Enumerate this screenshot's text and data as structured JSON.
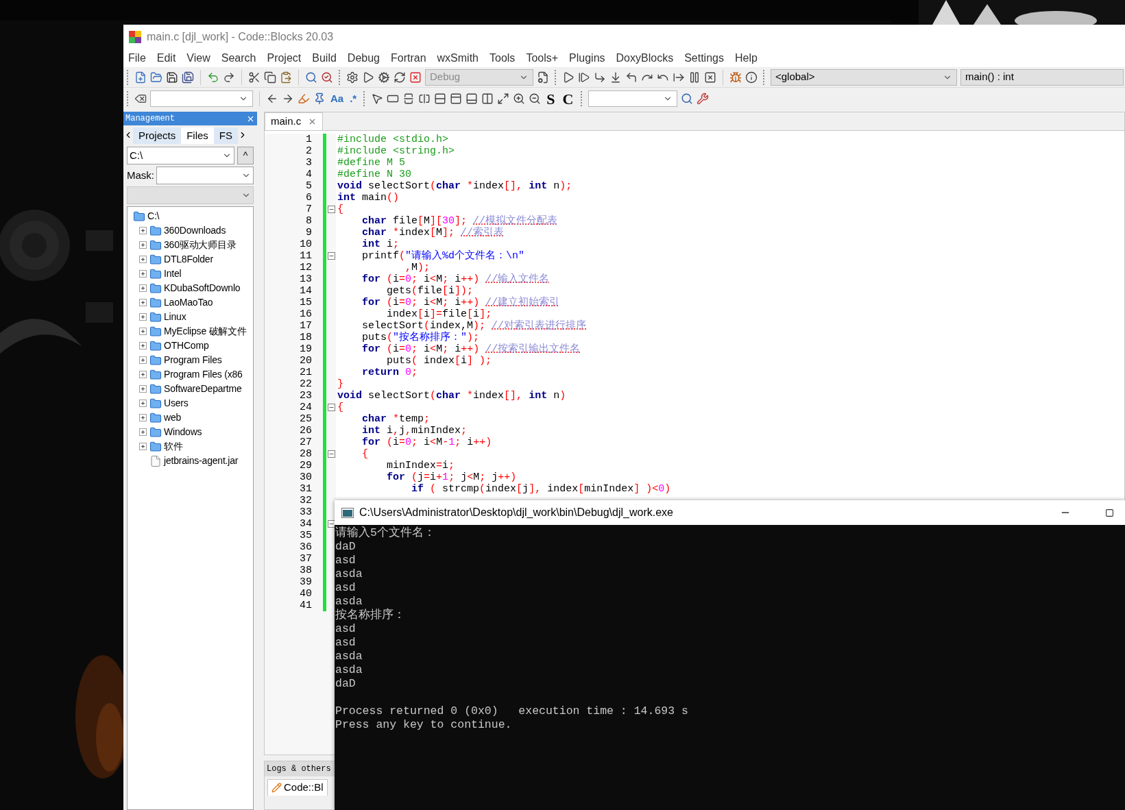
{
  "window": {
    "title": "main.c [djl_work] - Code::Blocks 20.03"
  },
  "menu": [
    "File",
    "Edit",
    "View",
    "Search",
    "Project",
    "Build",
    "Debug",
    "Fortran",
    "wxSmith",
    "Tools",
    "Tools+",
    "Plugins",
    "DoxyBlocks",
    "Settings",
    "Help"
  ],
  "toolbar": {
    "build_target": {
      "value": "Debug",
      "disabled": true
    },
    "scope": "<global>",
    "function": "main() : int",
    "text_buttons": [
      "Aa",
      ".*"
    ],
    "letter_buttons": [
      "S",
      "C"
    ]
  },
  "management": {
    "title": "Management",
    "tabs": [
      {
        "label": "Projects",
        "selected": false
      },
      {
        "label": "Files",
        "selected": true
      },
      {
        "label": "FS",
        "selected": false
      }
    ],
    "path": "C:\\",
    "up_button": "^",
    "mask_label": "Mask:",
    "tree": [
      {
        "label": "C:\\",
        "kind": "folder",
        "children": [
          {
            "label": "360Downloads",
            "kind": "folder",
            "expanded": false
          },
          {
            "label": "360驱动大师目录",
            "kind": "folder",
            "expanded": false
          },
          {
            "label": "DTL8Folder",
            "kind": "folder",
            "expanded": false
          },
          {
            "label": "Intel",
            "kind": "folder",
            "expanded": false
          },
          {
            "label": "KDubaSoftDownlo",
            "kind": "folder",
            "expanded": false
          },
          {
            "label": "LaoMaoTao",
            "kind": "folder",
            "expanded": false
          },
          {
            "label": "Linux",
            "kind": "folder",
            "expanded": false
          },
          {
            "label": "MyEclipse 破解文件",
            "kind": "folder",
            "expanded": false
          },
          {
            "label": "OTHComp",
            "kind": "folder",
            "expanded": false
          },
          {
            "label": "Program Files",
            "kind": "folder",
            "expanded": false
          },
          {
            "label": "Program Files (x86",
            "kind": "folder",
            "expanded": false
          },
          {
            "label": "SoftwareDepartme",
            "kind": "folder",
            "expanded": false
          },
          {
            "label": "Users",
            "kind": "folder",
            "expanded": false
          },
          {
            "label": "web",
            "kind": "folder",
            "expanded": false
          },
          {
            "label": "Windows",
            "kind": "folder",
            "expanded": false
          },
          {
            "label": "软件",
            "kind": "folder",
            "expanded": false
          },
          {
            "label": "jetbrains-agent.jar",
            "kind": "file"
          }
        ]
      }
    ]
  },
  "editor": {
    "tabs": [
      {
        "label": "main.c",
        "selected": true
      }
    ],
    "gutter": [
      {
        "number": "1",
        "fold": false
      },
      {
        "number": "2",
        "fold": false
      },
      {
        "number": "3",
        "fold": false
      },
      {
        "number": "4",
        "fold": false
      },
      {
        "number": "5",
        "fold": false
      },
      {
        "number": "6",
        "fold": false
      },
      {
        "number": "7",
        "fold": true
      },
      {
        "number": "8",
        "fold": false
      },
      {
        "number": "9",
        "fold": false
      },
      {
        "number": "10",
        "fold": false
      },
      {
        "number": "11",
        "fold": true
      },
      {
        "number": "12",
        "fold": false
      },
      {
        "number": "13",
        "fold": false
      },
      {
        "number": "14",
        "fold": false
      },
      {
        "number": "15",
        "fold": false
      },
      {
        "number": "16",
        "fold": false
      },
      {
        "number": "17",
        "fold": false
      },
      {
        "number": "18",
        "fold": false
      },
      {
        "number": "19",
        "fold": false
      },
      {
        "number": "20",
        "fold": false
      },
      {
        "number": "21",
        "fold": false
      },
      {
        "number": "22",
        "fold": false
      },
      {
        "number": "23",
        "fold": false
      },
      {
        "number": "24",
        "fold": true
      },
      {
        "number": "25",
        "fold": false
      },
      {
        "number": "26",
        "fold": false
      },
      {
        "number": "27",
        "fold": false
      },
      {
        "number": "28",
        "fold": true
      },
      {
        "number": "29",
        "fold": false
      },
      {
        "number": "30",
        "fold": false
      },
      {
        "number": "31",
        "fold": false
      },
      {
        "number": "32",
        "fold": false
      },
      {
        "number": "33",
        "fold": false
      },
      {
        "number": "34",
        "fold": true
      },
      {
        "number": "35",
        "fold": false
      },
      {
        "number": "36",
        "fold": false
      },
      {
        "number": "37",
        "fold": false
      },
      {
        "number": "38",
        "fold": false
      },
      {
        "number": "39",
        "fold": false
      },
      {
        "number": "40",
        "fold": false
      },
      {
        "number": "41",
        "fold": false
      }
    ],
    "code": [
      {
        "tokens": [
          {
            "kind": "pp",
            "text": "#include <stdio.h>"
          }
        ]
      },
      {
        "tokens": [
          {
            "kind": "pp",
            "text": "#include <string.h>"
          }
        ]
      },
      {
        "tokens": [
          {
            "kind": "pp",
            "text": "#define M 5"
          }
        ]
      },
      {
        "tokens": [
          {
            "kind": "pp",
            "text": "#define N 30"
          }
        ]
      },
      {
        "tokens": [
          {
            "kind": "kw",
            "text": "void"
          },
          {
            "kind": "p",
            "text": " selectSort"
          },
          {
            "kind": "op",
            "text": "("
          },
          {
            "kind": "kw",
            "text": "char"
          },
          {
            "kind": "op",
            "text": " *"
          },
          {
            "kind": "p",
            "text": "index"
          },
          {
            "kind": "op",
            "text": "[],"
          },
          {
            "kind": "kw",
            "text": " int"
          },
          {
            "kind": "p",
            "text": " n"
          },
          {
            "kind": "op",
            "text": ");"
          }
        ]
      },
      {
        "tokens": [
          {
            "kind": "kw",
            "text": "int"
          },
          {
            "kind": "p",
            "text": " main"
          },
          {
            "kind": "op",
            "text": "()"
          }
        ]
      },
      {
        "tokens": [
          {
            "kind": "op",
            "text": "{"
          }
        ]
      },
      {
        "tokens": [
          {
            "kind": "kw",
            "text": "    char"
          },
          {
            "kind": "p",
            "text": " file"
          },
          {
            "kind": "op",
            "text": "["
          },
          {
            "kind": "p",
            "text": "M"
          },
          {
            "kind": "op",
            "text": "]["
          },
          {
            "kind": "num",
            "text": "30"
          },
          {
            "kind": "op",
            "text": "]; "
          },
          {
            "kind": "cmt",
            "text": "//模拟文件分配表"
          }
        ]
      },
      {
        "tokens": [
          {
            "kind": "kw",
            "text": "    char"
          },
          {
            "kind": "op",
            "text": " *"
          },
          {
            "kind": "p",
            "text": "index"
          },
          {
            "kind": "op",
            "text": "["
          },
          {
            "kind": "p",
            "text": "M"
          },
          {
            "kind": "op",
            "text": "]; "
          },
          {
            "kind": "cmt",
            "text": "//索引表"
          }
        ]
      },
      {
        "tokens": [
          {
            "kind": "kw",
            "text": "    int"
          },
          {
            "kind": "p",
            "text": " i"
          },
          {
            "kind": "op",
            "text": ";"
          }
        ]
      },
      {
        "tokens": [
          {
            "kind": "p",
            "text": "    printf"
          },
          {
            "kind": "op",
            "text": "("
          },
          {
            "kind": "str",
            "text": "\"请输入%d个文件名：\\n\""
          }
        ]
      },
      {
        "tokens": [
          {
            "kind": "op",
            "text": "           ,"
          },
          {
            "kind": "p",
            "text": "M"
          },
          {
            "kind": "op",
            "text": ");"
          }
        ]
      },
      {
        "tokens": [
          {
            "kind": "kw",
            "text": "    for"
          },
          {
            "kind": "op",
            "text": " ("
          },
          {
            "kind": "p",
            "text": "i"
          },
          {
            "kind": "op",
            "text": "="
          },
          {
            "kind": "num",
            "text": "0"
          },
          {
            "kind": "op",
            "text": ";"
          },
          {
            "kind": "p",
            "text": " i"
          },
          {
            "kind": "op",
            "text": "<"
          },
          {
            "kind": "p",
            "text": "M"
          },
          {
            "kind": "op",
            "text": ";"
          },
          {
            "kind": "p",
            "text": " i"
          },
          {
            "kind": "op",
            "text": "++) "
          },
          {
            "kind": "cmt",
            "text": "//输入文件名"
          }
        ]
      },
      {
        "tokens": [
          {
            "kind": "p",
            "text": "        gets"
          },
          {
            "kind": "op",
            "text": "("
          },
          {
            "kind": "p",
            "text": "file"
          },
          {
            "kind": "op",
            "text": "["
          },
          {
            "kind": "p",
            "text": "i"
          },
          {
            "kind": "op",
            "text": "]);"
          }
        ]
      },
      {
        "tokens": [
          {
            "kind": "kw",
            "text": "    for"
          },
          {
            "kind": "op",
            "text": " ("
          },
          {
            "kind": "p",
            "text": "i"
          },
          {
            "kind": "op",
            "text": "="
          },
          {
            "kind": "num",
            "text": "0"
          },
          {
            "kind": "op",
            "text": ";"
          },
          {
            "kind": "p",
            "text": " i"
          },
          {
            "kind": "op",
            "text": "<"
          },
          {
            "kind": "p",
            "text": "M"
          },
          {
            "kind": "op",
            "text": ";"
          },
          {
            "kind": "p",
            "text": " i"
          },
          {
            "kind": "op",
            "text": "++) "
          },
          {
            "kind": "cmt",
            "text": "//建立初始索引"
          }
        ]
      },
      {
        "tokens": [
          {
            "kind": "p",
            "text": "        index"
          },
          {
            "kind": "op",
            "text": "["
          },
          {
            "kind": "p",
            "text": "i"
          },
          {
            "kind": "op",
            "text": "]="
          },
          {
            "kind": "p",
            "text": "file"
          },
          {
            "kind": "op",
            "text": "["
          },
          {
            "kind": "p",
            "text": "i"
          },
          {
            "kind": "op",
            "text": "];"
          }
        ]
      },
      {
        "tokens": [
          {
            "kind": "p",
            "text": "    selectSort"
          },
          {
            "kind": "op",
            "text": "("
          },
          {
            "kind": "p",
            "text": "index,M"
          },
          {
            "kind": "op",
            "text": "); "
          },
          {
            "kind": "cmt",
            "text": "//对索引表进行排序"
          }
        ]
      },
      {
        "tokens": [
          {
            "kind": "p",
            "text": "    puts"
          },
          {
            "kind": "op",
            "text": "("
          },
          {
            "kind": "str",
            "text": "\"按名称排序：\""
          },
          {
            "kind": "op",
            "text": ");"
          }
        ]
      },
      {
        "tokens": [
          {
            "kind": "kw",
            "text": "    for"
          },
          {
            "kind": "op",
            "text": " ("
          },
          {
            "kind": "p",
            "text": "i"
          },
          {
            "kind": "op",
            "text": "="
          },
          {
            "kind": "num",
            "text": "0"
          },
          {
            "kind": "op",
            "text": ";"
          },
          {
            "kind": "p",
            "text": " i"
          },
          {
            "kind": "op",
            "text": "<"
          },
          {
            "kind": "p",
            "text": "M"
          },
          {
            "kind": "op",
            "text": ";"
          },
          {
            "kind": "p",
            "text": " i"
          },
          {
            "kind": "op",
            "text": "++) "
          },
          {
            "kind": "cmt",
            "text": "//按索引输出文件名"
          }
        ]
      },
      {
        "tokens": [
          {
            "kind": "p",
            "text": "        puts"
          },
          {
            "kind": "op",
            "text": "("
          },
          {
            "kind": "p",
            "text": " index"
          },
          {
            "kind": "op",
            "text": "["
          },
          {
            "kind": "p",
            "text": "i"
          },
          {
            "kind": "op",
            "text": "]"
          },
          {
            "kind": "op",
            "text": " );"
          }
        ]
      },
      {
        "tokens": [
          {
            "kind": "kw",
            "text": "    return"
          },
          {
            "kind": "num",
            "text": " 0"
          },
          {
            "kind": "op",
            "text": ";"
          }
        ]
      },
      {
        "tokens": [
          {
            "kind": "op",
            "text": "}"
          }
        ]
      },
      {
        "tokens": [
          {
            "kind": "kw",
            "text": "void"
          },
          {
            "kind": "p",
            "text": " selectSort"
          },
          {
            "kind": "op",
            "text": "("
          },
          {
            "kind": "kw",
            "text": "char"
          },
          {
            "kind": "op",
            "text": " *"
          },
          {
            "kind": "p",
            "text": "index"
          },
          {
            "kind": "op",
            "text": "[],"
          },
          {
            "kind": "kw",
            "text": " int"
          },
          {
            "kind": "p",
            "text": " n"
          },
          {
            "kind": "op",
            "text": ")"
          }
        ]
      },
      {
        "tokens": [
          {
            "kind": "op",
            "text": "{"
          }
        ]
      },
      {
        "tokens": [
          {
            "kind": "kw",
            "text": "    char"
          },
          {
            "kind": "op",
            "text": " *"
          },
          {
            "kind": "p",
            "text": "temp"
          },
          {
            "kind": "op",
            "text": ";"
          }
        ]
      },
      {
        "tokens": [
          {
            "kind": "kw",
            "text": "    int"
          },
          {
            "kind": "p",
            "text": " i"
          },
          {
            "kind": "op",
            "text": ","
          },
          {
            "kind": "p",
            "text": "j"
          },
          {
            "kind": "op",
            "text": ","
          },
          {
            "kind": "p",
            "text": "minIndex"
          },
          {
            "kind": "op",
            "text": ";"
          }
        ]
      },
      {
        "tokens": [
          {
            "kind": "kw",
            "text": "    for"
          },
          {
            "kind": "op",
            "text": " ("
          },
          {
            "kind": "p",
            "text": "i"
          },
          {
            "kind": "op",
            "text": "="
          },
          {
            "kind": "num",
            "text": "0"
          },
          {
            "kind": "op",
            "text": ";"
          },
          {
            "kind": "p",
            "text": " i"
          },
          {
            "kind": "op",
            "text": "<"
          },
          {
            "kind": "p",
            "text": "M"
          },
          {
            "kind": "op",
            "text": "-"
          },
          {
            "kind": "num",
            "text": "1"
          },
          {
            "kind": "op",
            "text": ";"
          },
          {
            "kind": "p",
            "text": " i"
          },
          {
            "kind": "op",
            "text": "++)"
          }
        ]
      },
      {
        "tokens": [
          {
            "kind": "op",
            "text": "    {"
          }
        ]
      },
      {
        "tokens": [
          {
            "kind": "p",
            "text": "        minIndex"
          },
          {
            "kind": "op",
            "text": "="
          },
          {
            "kind": "p",
            "text": "i"
          },
          {
            "kind": "op",
            "text": ";"
          }
        ]
      },
      {
        "tokens": [
          {
            "kind": "kw",
            "text": "        for"
          },
          {
            "kind": "op",
            "text": " ("
          },
          {
            "kind": "p",
            "text": "j"
          },
          {
            "kind": "op",
            "text": "="
          },
          {
            "kind": "p",
            "text": "i"
          },
          {
            "kind": "op",
            "text": "+"
          },
          {
            "kind": "num",
            "text": "1"
          },
          {
            "kind": "op",
            "text": ";"
          },
          {
            "kind": "p",
            "text": " j"
          },
          {
            "kind": "op",
            "text": "<"
          },
          {
            "kind": "p",
            "text": "M"
          },
          {
            "kind": "op",
            "text": ";"
          },
          {
            "kind": "p",
            "text": " j"
          },
          {
            "kind": "op",
            "text": "++)"
          }
        ]
      },
      {
        "tokens": [
          {
            "kind": "kw",
            "text": "            if"
          },
          {
            "kind": "op",
            "text": " ("
          },
          {
            "kind": "p",
            "text": " strcmp"
          },
          {
            "kind": "op",
            "text": "("
          },
          {
            "kind": "p",
            "text": "index"
          },
          {
            "kind": "op",
            "text": "["
          },
          {
            "kind": "p",
            "text": "j"
          },
          {
            "kind": "op",
            "text": "],"
          },
          {
            "kind": "p",
            "text": " index"
          },
          {
            "kind": "op",
            "text": "["
          },
          {
            "kind": "p",
            "text": "minIndex"
          },
          {
            "kind": "op",
            "text": "]"
          },
          {
            "kind": "op",
            "text": " )<"
          },
          {
            "kind": "num",
            "text": "0"
          },
          {
            "kind": "op",
            "text": ")"
          }
        ]
      }
    ]
  },
  "logs": {
    "title": "Logs & others",
    "tab": "Code::Bl"
  },
  "console": {
    "title": "C:\\Users\\Administrator\\Desktop\\djl_work\\bin\\Debug\\djl_work.exe",
    "lines": [
      "请输入5个文件名：",
      "daD",
      "asd",
      "asda",
      "asd",
      "asda",
      "按名称排序：",
      "asd",
      "asd",
      "asda",
      "asda",
      "daD"
    ],
    "footer": [
      "Process returned 0 (0x0)   execution time : 14.693 s",
      "Press any key to continue."
    ]
  }
}
